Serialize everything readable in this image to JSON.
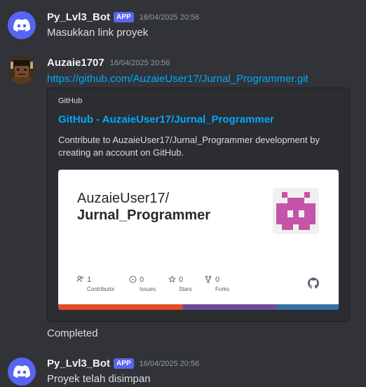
{
  "messages": [
    {
      "username": "Py_Lvl3_Bot",
      "tag": "APP",
      "timestamp": "16/04/2025 20:56",
      "text": "Masukkan link proyek"
    },
    {
      "username": "Auzaie1707",
      "timestamp": "16/04/2025 20:56",
      "link": "https://github.com/AuzaieUser17/Jurnal_Programmer.git",
      "followup": "Completed"
    },
    {
      "username": "Py_Lvl3_Bot",
      "tag": "APP",
      "timestamp": "16/04/2025 20:56",
      "text": "Proyek telah disimpan"
    }
  ],
  "embed": {
    "provider": "GitHub",
    "title": "GitHub - AuzaieUser17/Jurnal_Programmer",
    "description": "Contribute to AuzaieUser17/Jurnal_Programmer development by creating an account on GitHub.",
    "card": {
      "owner": "AuzaieUser17/",
      "repo": "Jurnal_Programmer",
      "stats": [
        {
          "icon": "people-icon",
          "count": "1",
          "label": "Contributor"
        },
        {
          "icon": "issues-icon",
          "count": "0",
          "label": "Issues"
        },
        {
          "icon": "star-icon",
          "count": "0",
          "label": "Stars"
        },
        {
          "icon": "fork-icon",
          "count": "0",
          "label": "Forks"
        }
      ],
      "language_colors": [
        "#e34c26",
        "#6e4c9a",
        "#3572a5"
      ],
      "logo_color": "#c454a8"
    }
  },
  "colors": {
    "background": "#313338",
    "link": "#00a8fc",
    "app_tag": "#5865f2"
  }
}
